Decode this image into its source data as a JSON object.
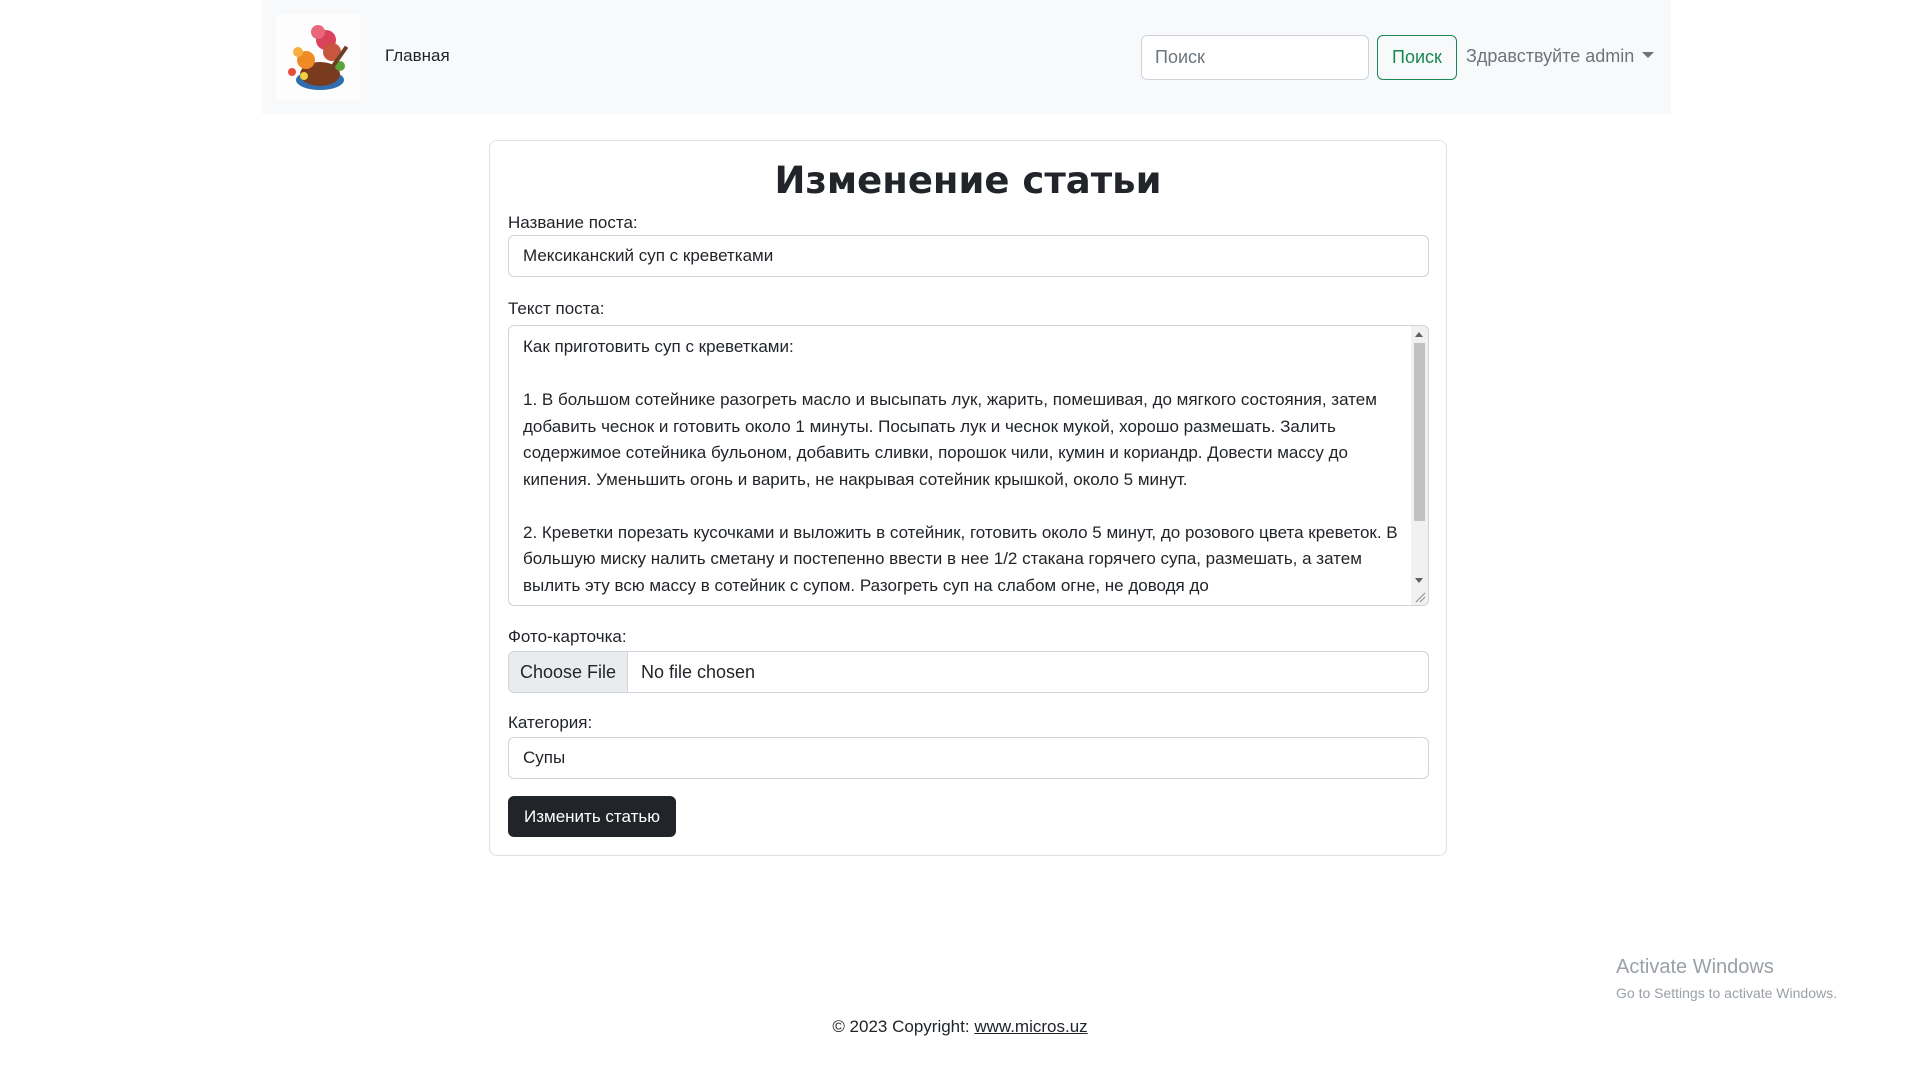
{
  "navbar": {
    "home_label": "Главная",
    "search_placeholder": "Поиск",
    "search_button": "Поиск",
    "user_greeting": "Здравствуйте admin"
  },
  "form": {
    "title": "Изменение статьи",
    "name_label": "Название поста:",
    "name_value": "Мексиканский суп с креветками",
    "text_label": "Текст поста:",
    "text_value": "Как приготовить суп с креветками:\n\n1. В большом сотейнике разогреть масло и высыпать лук, жарить, помешивая, до мягкого состояния, затем добавить чеснок и готовить около 1 минуты. Посыпать лук и чеснок мукой, хорошо размешать. Залить содержимое сотейника бульоном, добавить сливки, порошок чили, кумин и кориандр. Довести массу до кипения. Уменьшить огонь и варить, не накрывая сотейник крышкой, около 5 минут.\n\n2. Креветки порезать кусочками и выложить в сотейник, готовить около 5 минут, до розового цвета креветок. В большую миску налить сметану и постепенно ввести в нее 1/2 стакана горячего супа, размешать, а затем вылить эту всю массу в сотейник с супом. Разогреть суп на слабом огне, не доводя до",
    "photo_label": "Фото-карточка:",
    "file_button": "Choose File",
    "file_status": "No file chosen",
    "category_label": "Категория:",
    "category_value": "Супы",
    "submit_label": "Изменить статью"
  },
  "watermark": {
    "title": "Activate Windows",
    "subtitle": "Go to Settings to activate Windows."
  },
  "footer": {
    "copyright": "© 2023 Copyright: ",
    "link_text": "www.micros.uz"
  }
}
